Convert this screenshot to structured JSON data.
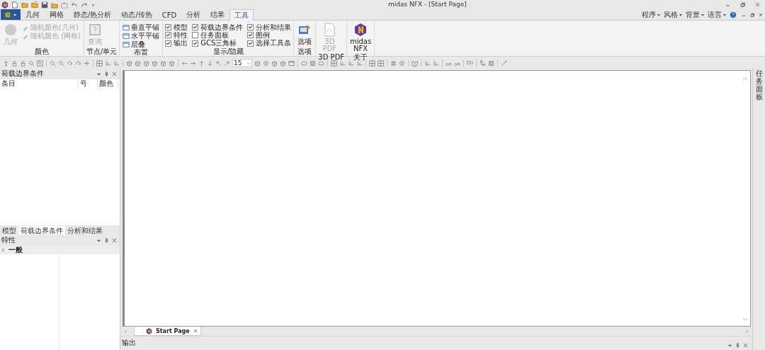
{
  "window": {
    "title": "midas NFX - [Start Page]"
  },
  "ribbon_tabs": [
    {
      "label": "几何",
      "selected": false
    },
    {
      "label": "网格",
      "selected": false
    },
    {
      "label": "静态/热分析",
      "selected": false
    },
    {
      "label": "动态/传热",
      "selected": false
    },
    {
      "label": "CFD",
      "selected": false
    },
    {
      "label": "分析",
      "selected": false
    },
    {
      "label": "结果",
      "selected": false
    },
    {
      "label": "工具",
      "selected": true
    }
  ],
  "top_right_menus": [
    "程序",
    "风格",
    "背景",
    "语言"
  ],
  "ribbon": {
    "color_group": {
      "label": "颜色",
      "large_button": {
        "label": "几何",
        "disabled": true
      },
      "items": [
        {
          "label": "随机颜色(几何)",
          "disabled": true
        },
        {
          "label": "随机颜色 (网格)",
          "disabled": true
        }
      ]
    },
    "node_group": {
      "label": "节点/单元",
      "button": {
        "label": "查询",
        "disabled": true
      }
    },
    "layout_group": {
      "label": "布置",
      "items": [
        "垂直平铺",
        "水平平铺",
        "层叠"
      ]
    },
    "display_group": {
      "label": "显示/隐藏",
      "checkboxes": [
        {
          "label": "模型",
          "checked": true
        },
        {
          "label": "荷载边界条件",
          "checked": true
        },
        {
          "label": "分析和结果",
          "checked": true
        },
        {
          "label": "特性",
          "checked": true
        },
        {
          "label": "任务面板",
          "checked": false
        },
        {
          "label": "图例",
          "checked": true
        },
        {
          "label": "输出",
          "checked": true
        },
        {
          "label": "GCS三角标",
          "checked": true
        },
        {
          "label": "选择工具条",
          "checked": true
        }
      ]
    },
    "options_group": {
      "label": "选项",
      "button": {
        "label": "选项",
        "disabled": false
      }
    },
    "pdf_group": {
      "label": "3D PDF",
      "button": {
        "label": "3D PDF",
        "disabled": true
      }
    },
    "about_group": {
      "label": "关于",
      "button": {
        "label": "midas NFX",
        "disabled": false
      }
    }
  },
  "toolbar": {
    "zoom_value": "15"
  },
  "left_panel": {
    "title": "荷载边界条件",
    "columns": [
      "条目",
      "号",
      "颜色"
    ],
    "tabs": [
      {
        "label": "模型",
        "selected": false
      },
      {
        "label": "荷载边界条件",
        "selected": true
      },
      {
        "label": "分析和结果",
        "selected": false
      }
    ]
  },
  "properties_panel": {
    "title": "特性",
    "groups": [
      {
        "label": "一般",
        "expanded": false
      }
    ]
  },
  "document_tabs": [
    {
      "label": "Start Page",
      "selected": true
    }
  ],
  "output_panel": {
    "title": "输出"
  },
  "side_strip": {
    "label": "任务面板"
  }
}
